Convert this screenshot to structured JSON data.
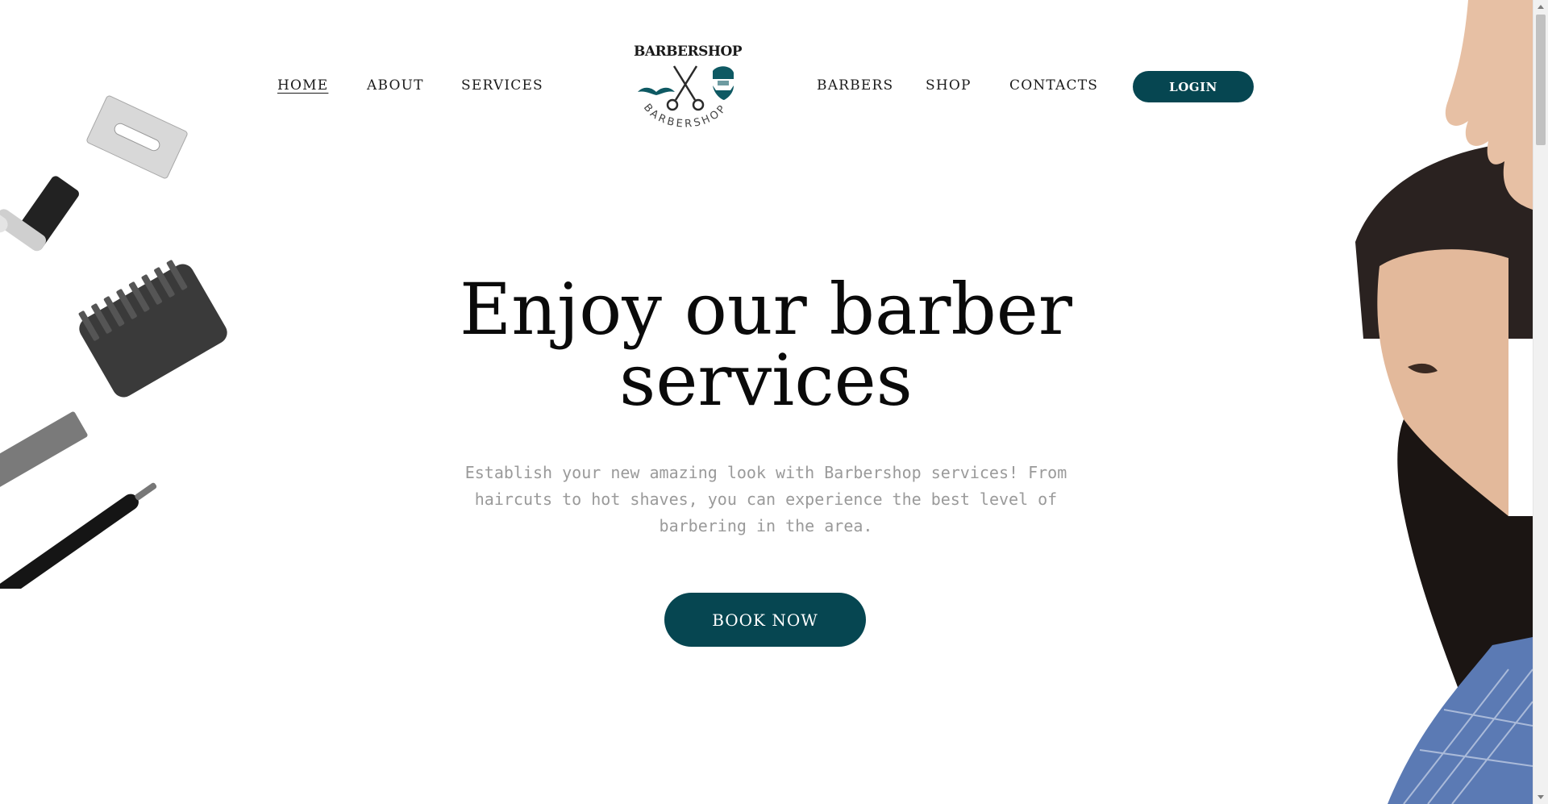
{
  "nav": {
    "left": [
      {
        "label": "HOME",
        "active": true
      },
      {
        "label": "ABOUT"
      },
      {
        "label": "SERVICES"
      }
    ],
    "right": [
      {
        "label": "BARBERS"
      },
      {
        "label": "SHOP"
      },
      {
        "label": "CONTACTS"
      }
    ],
    "login_label": "LOGIN"
  },
  "logo": {
    "top_text": "BARBERSHOP",
    "arc_text": "BARBERSHOP"
  },
  "hero": {
    "title_line1": "Enjoy our barber",
    "title_line2": "services",
    "text": "Establish your new amazing look with Barbershop services! From haircuts to hot shaves, you can experience the best level of barbering in the area.",
    "cta_label": "BOOK NOW"
  },
  "colors": {
    "accent": "#064651",
    "text": "#0a0a0a",
    "muted_text": "#9a9a9a",
    "background": "#ffffff"
  },
  "icons": {
    "logo_left": "mustache-icon",
    "logo_center": "scissors-icon",
    "logo_right": "bearded-man-icon"
  }
}
